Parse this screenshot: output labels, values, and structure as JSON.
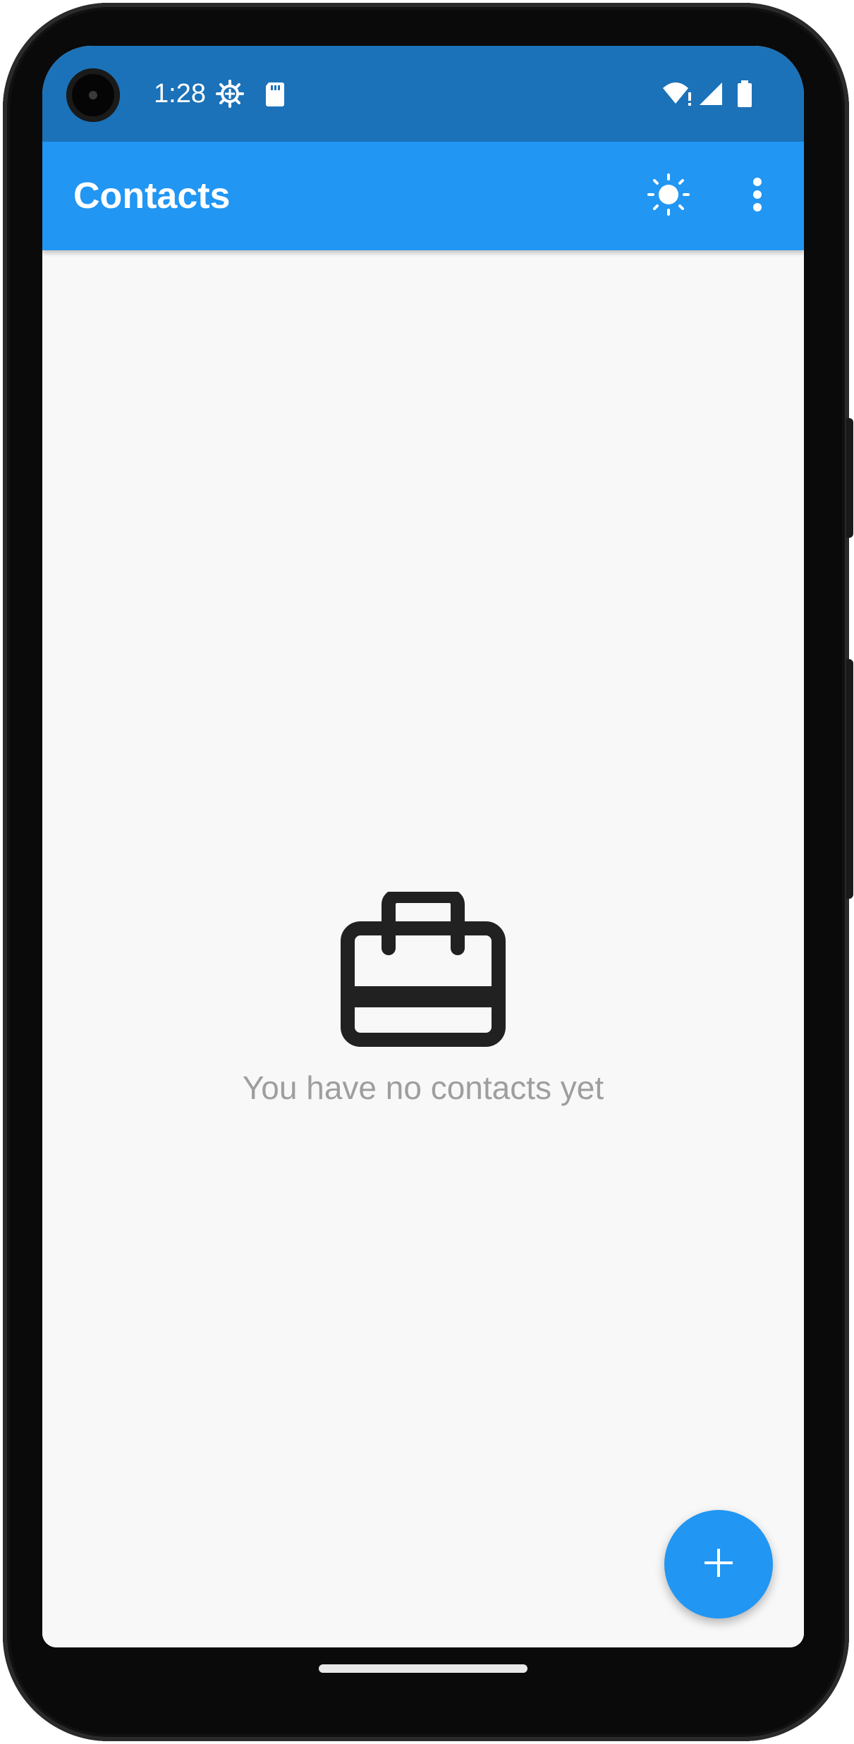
{
  "status_bar": {
    "time": "1:28",
    "left_icons": [
      "settings-gear-icon",
      "sd-card-icon"
    ],
    "right_icons": [
      "wifi-alert-icon",
      "cell-signal-icon",
      "battery-icon"
    ],
    "background": "#1b72b8"
  },
  "app_bar": {
    "title": "Contacts",
    "background": "#2196f3",
    "actions": [
      {
        "name": "theme-toggle",
        "icon": "sun-icon"
      },
      {
        "name": "overflow-menu",
        "icon": "more-vert-icon"
      }
    ]
  },
  "empty_state": {
    "icon": "toolbox-icon",
    "message": "You have no contacts yet",
    "text_color": "#9e9e9e"
  },
  "fab": {
    "icon": "plus-icon",
    "color": "#2196f3"
  }
}
